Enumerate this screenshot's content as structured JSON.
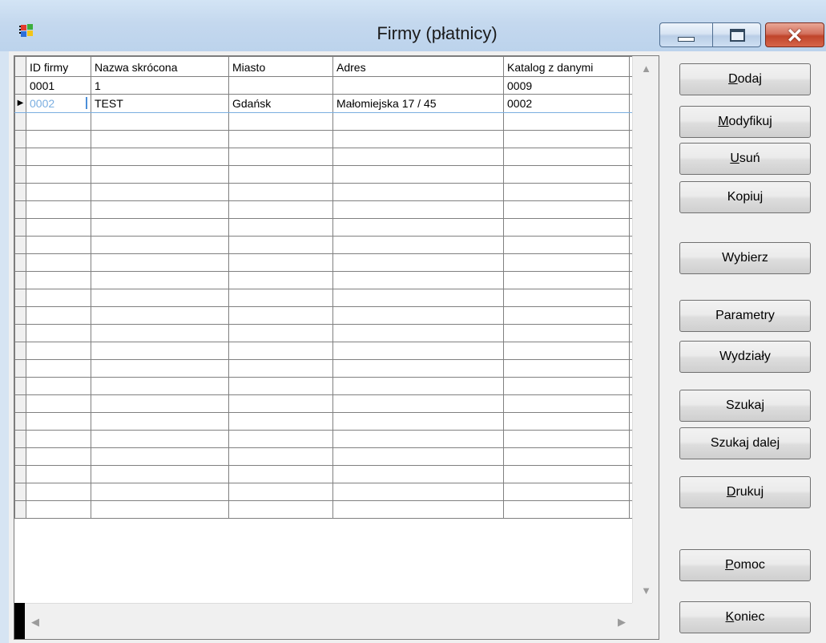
{
  "window": {
    "title": "Firmy (płatnicy)",
    "icon": "windows-flag-icon",
    "controls": {
      "minimize": "minimize-icon",
      "maximize": "maximize-icon",
      "close": "close-icon"
    }
  },
  "grid": {
    "columns": [
      "ID firmy",
      "Nazwa skrócona",
      "Miasto",
      "Adres",
      "Katalog z danymi"
    ],
    "rows": [
      [
        "0001",
        "1",
        "",
        "",
        "0009"
      ],
      [
        "0002",
        "TEST",
        "Gdańsk",
        "Małomiejska 17 / 45",
        "0002"
      ]
    ],
    "active_row": 1
  },
  "buttons": [
    {
      "label": "Dodaj",
      "accel_index": 0
    },
    {
      "label": "Modyfikuj",
      "accel_index": 0
    },
    {
      "label": "Usuń",
      "accel_index": 0
    },
    {
      "label": "Kopiuj",
      "accel_index": -1
    },
    {
      "label": "Wybierz",
      "accel_index": -1
    },
    {
      "label": "Parametry",
      "accel_index": -1
    },
    {
      "label": "Wydziały",
      "accel_index": -1
    },
    {
      "label": "Szukaj",
      "accel_index": -1
    },
    {
      "label": "Szukaj dalej",
      "accel_index": -1
    },
    {
      "label": "Drukuj",
      "accel_index": 0
    },
    {
      "label": "Pomoc",
      "accel_index": 0
    },
    {
      "label": "Koniec",
      "accel_index": 0
    }
  ]
}
